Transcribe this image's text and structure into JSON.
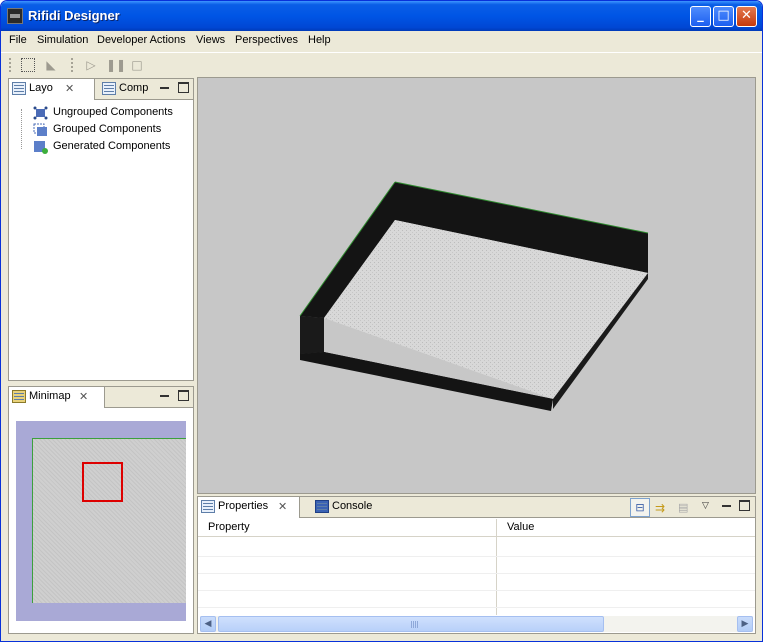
{
  "window": {
    "title": "Rifidi Designer",
    "controls": {
      "minimize": "_",
      "maximize": "□",
      "close": "✕"
    }
  },
  "menu": [
    "File",
    "Simulation",
    "Developer Actions",
    "Views",
    "Perspectives",
    "Help"
  ],
  "toolbar": {
    "tools": [
      "select-tool-icon",
      "pan-tool-icon",
      "play-icon",
      "pause-icon",
      "stop-icon"
    ]
  },
  "layout_view": {
    "tabs": [
      {
        "label": "Layo",
        "icon": "list-icon",
        "close": "✕"
      },
      {
        "label": "Comp",
        "icon": "list-icon"
      }
    ],
    "items": [
      {
        "label": "Ungrouped Components",
        "icon": "ungrouped-components-icon"
      },
      {
        "label": "Grouped Components",
        "icon": "grouped-components-icon"
      },
      {
        "label": "Generated Components",
        "icon": "generated-components-icon"
      }
    ]
  },
  "minimap_view": {
    "tab": {
      "label": "Minimap",
      "icon": "minimap-icon",
      "close": "✕"
    },
    "colors": {
      "frame": "#a9a9d6",
      "border": "#3ca03c",
      "viewport": "#dd0000"
    }
  },
  "scene": {
    "background": "#c7c7c7",
    "room_colors": {
      "wall": "#141414",
      "floor": "#d6d6d6",
      "edge": "#2e8b2e"
    }
  },
  "bottom_view": {
    "tabs": [
      {
        "label": "Properties",
        "icon": "properties-icon",
        "close": "✕"
      },
      {
        "label": "Console",
        "icon": "console-icon"
      }
    ],
    "actions": [
      "tree-view-icon",
      "advanced-properties-icon",
      "restore-defaults-icon",
      "view-menu-icon"
    ],
    "columns": [
      "Property",
      "Value"
    ],
    "scroll": {
      "left": "◀",
      "right": "▶"
    }
  }
}
